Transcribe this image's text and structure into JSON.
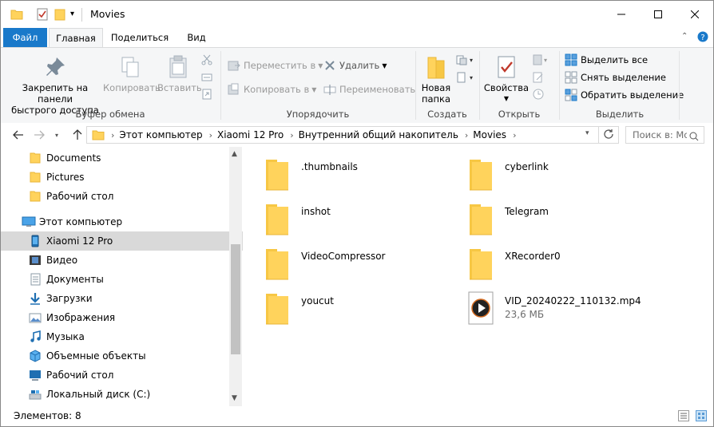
{
  "window": {
    "title": "Movies"
  },
  "tabs": {
    "file": "Файл",
    "home": "Главная",
    "share": "Поделиться",
    "view": "Вид"
  },
  "ribbon": {
    "clipboard": {
      "label": "Буфер обмена",
      "pin_line1": "Закрепить на панели",
      "pin_line2": "быстрого доступа",
      "copy": "Копировать",
      "paste": "Вставить"
    },
    "organize": {
      "label": "Упорядочить",
      "move_to": "Переместить в",
      "copy_to": "Копировать в",
      "delete": "Удалить",
      "rename": "Переименовать"
    },
    "new": {
      "label": "Создать",
      "new_folder_line1": "Новая",
      "new_folder_line2": "папка"
    },
    "open": {
      "label": "Открыть",
      "properties": "Свойства"
    },
    "select": {
      "label": "Выделить",
      "select_all": "Выделить все",
      "select_none": "Снять выделение",
      "invert": "Обратить выделение"
    }
  },
  "address": {
    "crumbs": [
      "Этот компьютер",
      "Xiaomi 12 Pro",
      "Внутренний общий накопитель",
      "Movies"
    ],
    "search_placeholder": "Поиск в: Movies"
  },
  "nav": {
    "items": [
      {
        "label": "Documents",
        "icon": "folder-icon"
      },
      {
        "label": "Pictures",
        "icon": "folder-icon"
      },
      {
        "label": "Рабочий стол",
        "icon": "folder-icon"
      },
      {
        "label": "Этот компьютер",
        "icon": "computer-icon"
      },
      {
        "label": "Xiaomi 12 Pro",
        "icon": "phone-icon"
      },
      {
        "label": "Видео",
        "icon": "video-icon"
      },
      {
        "label": "Документы",
        "icon": "documents-icon"
      },
      {
        "label": "Загрузки",
        "icon": "download-icon"
      },
      {
        "label": "Изображения",
        "icon": "pictures-icon"
      },
      {
        "label": "Музыка",
        "icon": "music-icon"
      },
      {
        "label": "Объемные объекты",
        "icon": "3d-objects-icon"
      },
      {
        "label": "Рабочий стол",
        "icon": "desktop-icon"
      },
      {
        "label": "Локальный диск (C:)",
        "icon": "drive-icon"
      }
    ]
  },
  "files": [
    {
      "name": ".thumbnails",
      "type": "folder"
    },
    {
      "name": "cyberlink",
      "type": "folder"
    },
    {
      "name": "inshot",
      "type": "folder"
    },
    {
      "name": "Telegram",
      "type": "folder"
    },
    {
      "name": "VideoCompressor",
      "type": "folder"
    },
    {
      "name": "XRecorder0",
      "type": "folder"
    },
    {
      "name": "youcut",
      "type": "folder"
    },
    {
      "name": "VID_20240222_110132.mp4",
      "type": "video",
      "size": "23,6 МБ"
    }
  ],
  "status": {
    "count": "Элементов: 8"
  },
  "colors": {
    "accent": "#1979ca",
    "folder": "#ffd35c",
    "folder_dark": "#e8b637",
    "selected": "#d9d9d9"
  }
}
